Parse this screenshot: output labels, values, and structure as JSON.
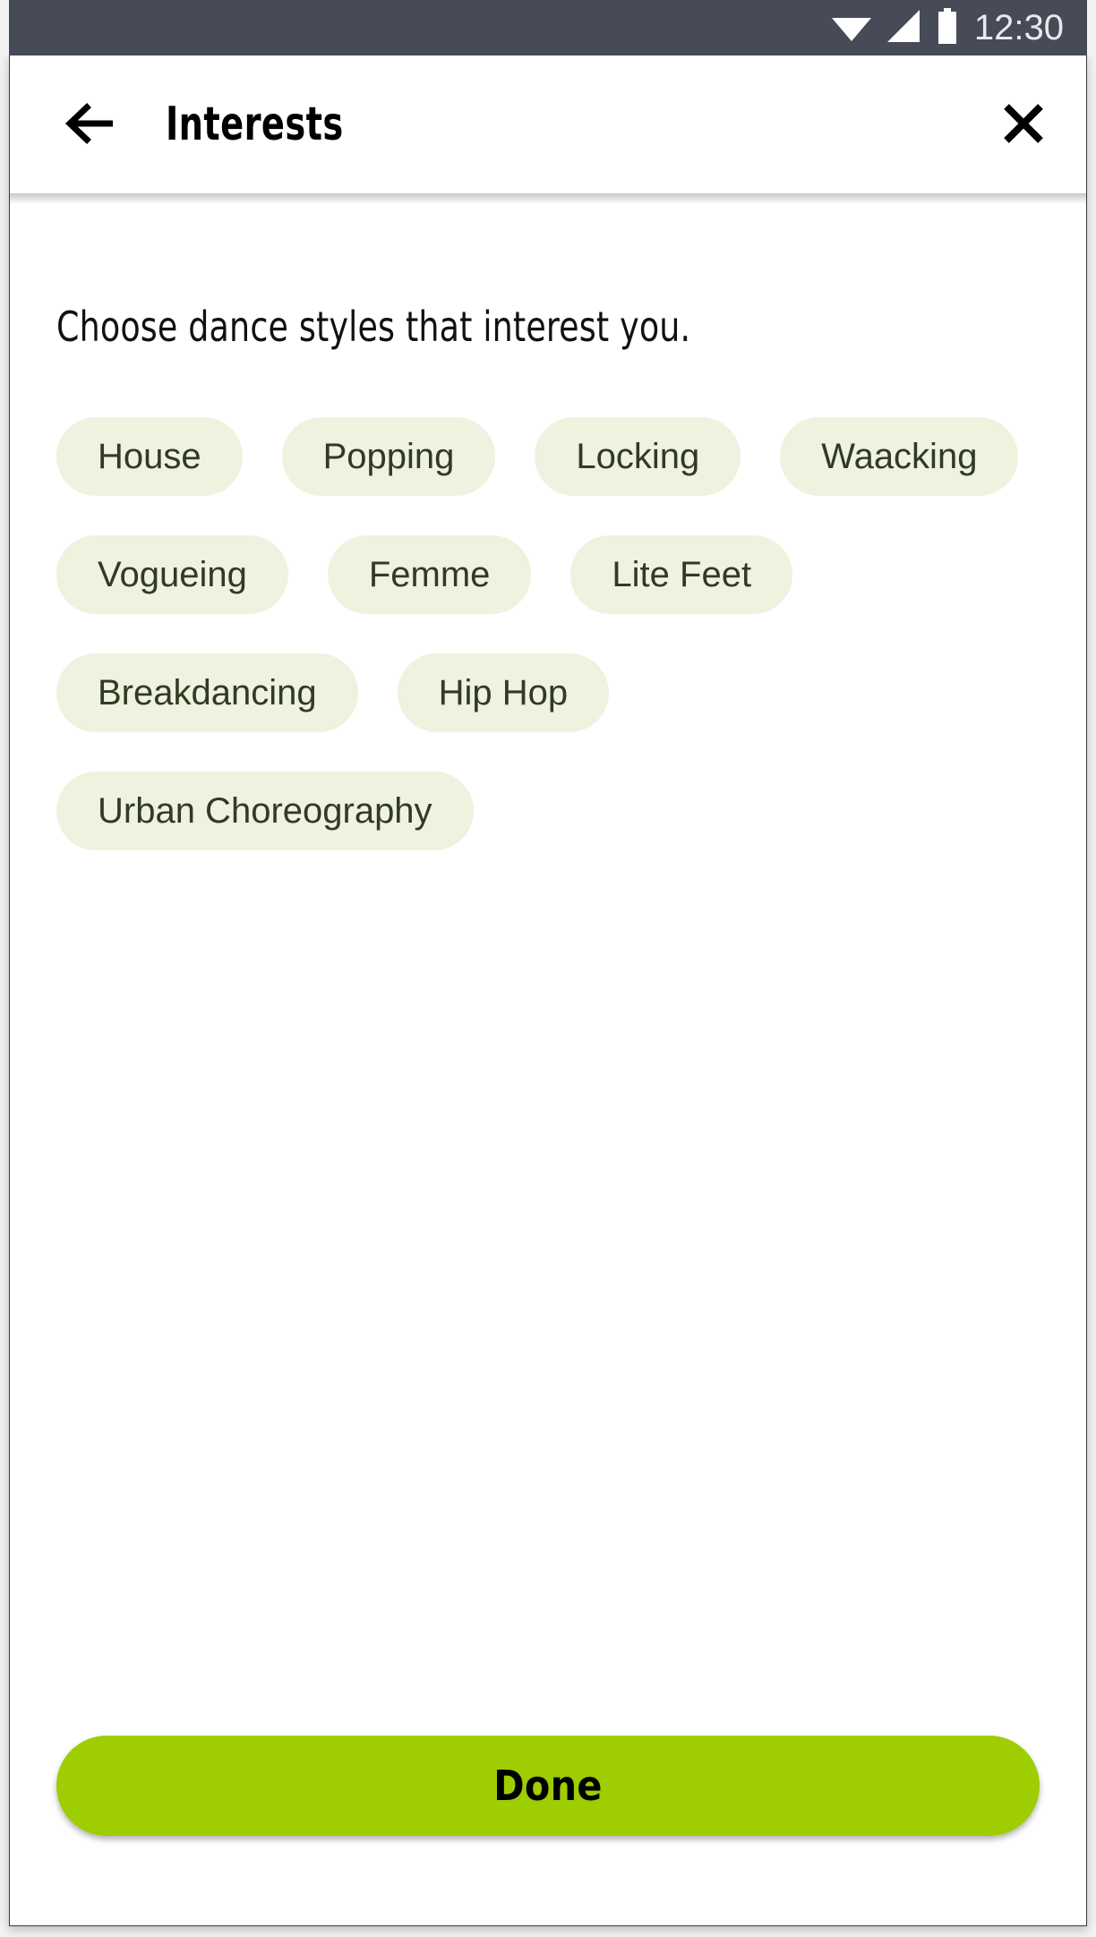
{
  "status_bar": {
    "time": "12:30",
    "icons": [
      "wifi-icon",
      "cellular-signal-icon",
      "battery-icon"
    ],
    "background_color": "#474a57",
    "text_color": "#e9e9ec"
  },
  "app_bar": {
    "back_label": "Back",
    "title": "Interests",
    "close_label": "Close"
  },
  "content": {
    "prompt": "Choose dance styles that interest you.",
    "chips": [
      {
        "label": "House",
        "selected": false
      },
      {
        "label": "Popping",
        "selected": false
      },
      {
        "label": "Locking",
        "selected": false
      },
      {
        "label": "Waacking",
        "selected": false
      },
      {
        "label": "Vogueing",
        "selected": false
      },
      {
        "label": "Femme",
        "selected": false
      },
      {
        "label": "Lite Feet",
        "selected": false
      },
      {
        "label": "Breakdancing",
        "selected": false
      },
      {
        "label": "Hip Hop",
        "selected": false
      },
      {
        "label": "Urban Choreography",
        "selected": false
      }
    ],
    "chip_background_color": "#eef2df",
    "chip_text_color": "#313a22"
  },
  "footer": {
    "done_label": "Done",
    "done_background_color": "#9ECE02",
    "done_text_color": "#000000"
  }
}
